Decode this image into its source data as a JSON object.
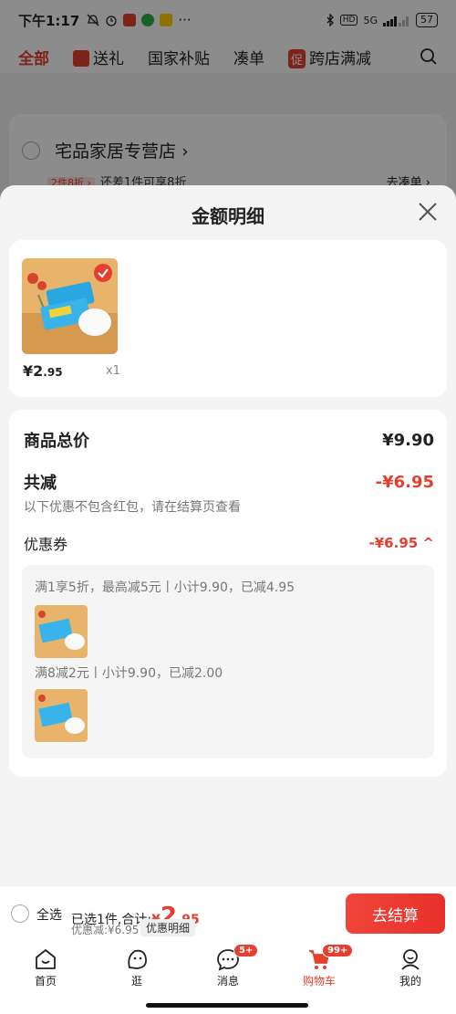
{
  "status": {
    "time": "下午1:17",
    "battery": "57",
    "network": "5G"
  },
  "topnav": {
    "all": "全部",
    "gift": "送礼",
    "subsidy": "国家补贴",
    "bundle": "凑单",
    "cu_badge": "促",
    "cross_store": "跨店满减"
  },
  "store": {
    "name": "宅品家居专营店",
    "chevron": "›",
    "promo_tag": "2件8折 ›",
    "promo_text": "还差1件可享8折",
    "go_bundle": "去凑单 ›"
  },
  "sheet": {
    "title": "金额明细",
    "product": {
      "price_symbol": "¥",
      "price_int": "2",
      "price_dec": ".95",
      "qty": "x1"
    },
    "total": {
      "label": "商品总价",
      "value": "¥9.90"
    },
    "discount": {
      "label": "共减",
      "value": "-¥6.95",
      "note": "以下优惠不包含红包，请在结算页查看"
    },
    "coupon": {
      "label": "优惠券",
      "value": "-¥6.95",
      "chevron": "^",
      "items": [
        {
          "text": "满1享5折，最高减5元丨小计9.90，已减4.95"
        },
        {
          "text": "满8减2元丨小计9.90，已减2.00"
        }
      ]
    }
  },
  "bottombar": {
    "select_all": "全选",
    "selected_prefix": "已选1件,合计:",
    "total_symbol": "¥",
    "total_int": "2",
    "total_dec": ".95",
    "discount": "优惠减:¥6.95",
    "detail": "优惠明细",
    "checkout": "去结算"
  },
  "tabs": [
    {
      "label": "首页"
    },
    {
      "label": "逛"
    },
    {
      "label": "消息",
      "badge": "5+"
    },
    {
      "label": "购物车",
      "badge": "99+"
    },
    {
      "label": "我的"
    }
  ],
  "colors": {
    "accent": "#e5402f"
  }
}
